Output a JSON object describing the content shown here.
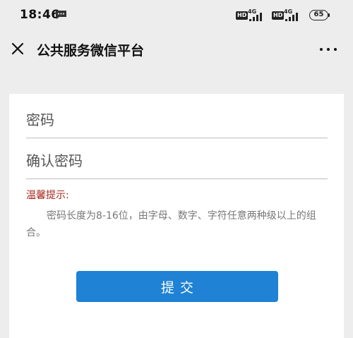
{
  "status_bar": {
    "time": "18:46",
    "hd_badge_1": "HD",
    "network_1": "4G",
    "hd_badge_2": "HD",
    "network_2": "4G",
    "battery": "65",
    "icons": [
      "message-icon",
      "signal-icon",
      "signal-icon",
      "battery-icon"
    ]
  },
  "nav": {
    "title": "公共服务微信平台",
    "close_icon": "close-icon",
    "more_icon": "more-icon"
  },
  "form": {
    "password_placeholder": "密码",
    "password_value": "",
    "confirm_placeholder": "确认密码",
    "confirm_value": "",
    "tips_title": "温馨提示:",
    "tips_text": "密码长度为8-16位，由字母、数字、字符任意两种级以上的组合。",
    "submit_label": "提交"
  },
  "colors": {
    "page_bg": "#ededed",
    "card_bg": "#ffffff",
    "tips_title": "#a6261c",
    "tips_text": "#777777",
    "button_bg": "#1f82d4"
  }
}
